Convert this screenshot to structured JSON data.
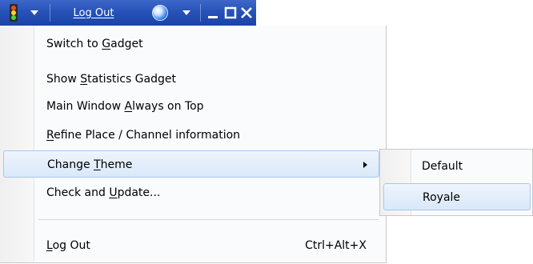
{
  "titlebar": {
    "status_icon": "traffic-light-icon",
    "logout_label": "Log Out",
    "help_icon": "help-ball-icon",
    "minimize_icon": "minimize-icon",
    "maximize_icon": "maximize-icon",
    "close_icon": "close-icon"
  },
  "menu": {
    "items": [
      {
        "pre": "Switch to ",
        "key": "G",
        "post": "adget"
      },
      {
        "pre": "Show ",
        "key": "S",
        "post": "tatistics Gadget"
      },
      {
        "pre": "Main Window ",
        "key": "A",
        "post": "lways on Top"
      },
      {
        "pre": "",
        "key": "R",
        "post": "efine Place / Channel information"
      },
      {
        "pre": "Change ",
        "key": "T",
        "post": "heme"
      },
      {
        "pre": "Check and ",
        "key": "U",
        "post": "pdate..."
      },
      {
        "pre": "",
        "key": "L",
        "post": "og Out",
        "shortcut": "Ctrl+Alt+X"
      }
    ]
  },
  "submenu": {
    "items": [
      {
        "label": "Default"
      },
      {
        "label": "Royale"
      }
    ]
  }
}
